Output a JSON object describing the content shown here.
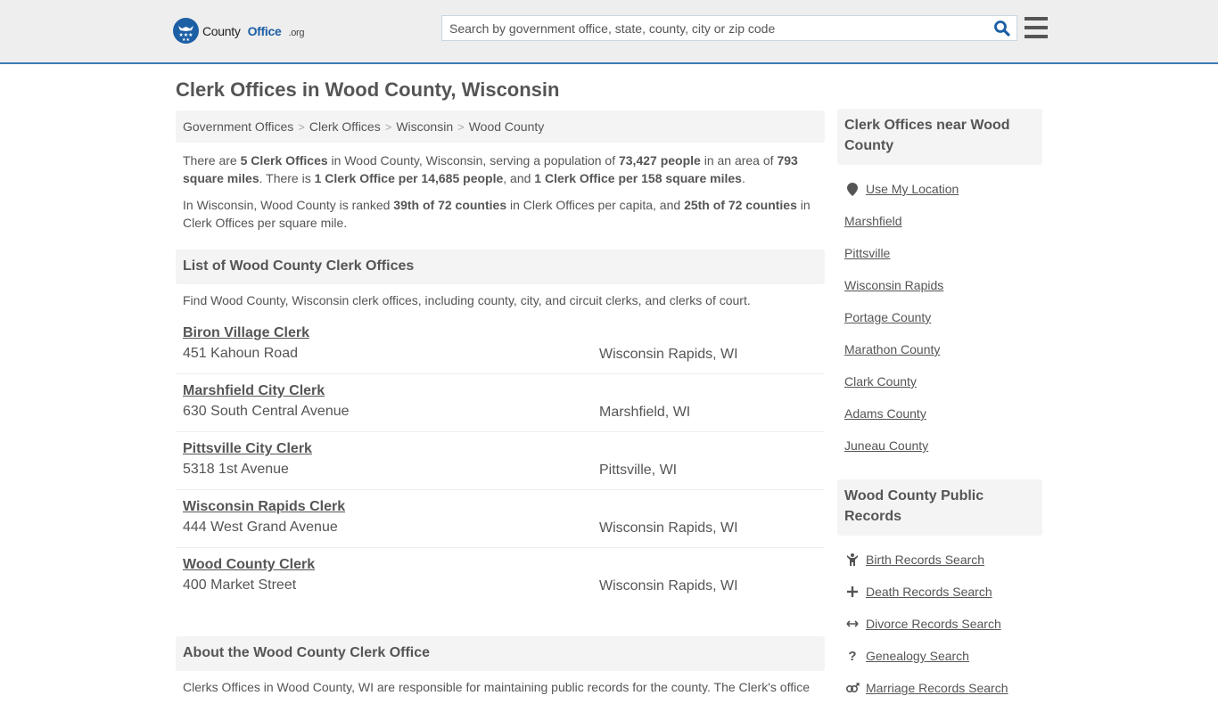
{
  "header": {
    "logo": {
      "brand_part1": "County",
      "brand_part2": "Office",
      "brand_suffix": ".org"
    },
    "search": {
      "placeholder": "Search by government office, state, county, city or zip code",
      "value": ""
    },
    "colors": {
      "brand_blue": "#1c5fa5",
      "header_border": "#3a7cb8"
    }
  },
  "page": {
    "title": "Clerk Offices in Wood County, Wisconsin"
  },
  "breadcrumb": [
    {
      "label": "Government Offices"
    },
    {
      "label": "Clerk Offices"
    },
    {
      "label": "Wisconsin"
    },
    {
      "label": "Wood County"
    }
  ],
  "intro": {
    "p1": {
      "t1": "There are ",
      "b1": "5 Clerk Offices",
      "t2": " in Wood County, Wisconsin, serving a population of ",
      "b2": "73,427 people",
      "t3": " in an area of ",
      "b3": "793 square miles",
      "t4": ". There is ",
      "b4": "1 Clerk Office per 14,685 people",
      "t5": ", and ",
      "b5": "1 Clerk Office per 158 square miles",
      "t6": "."
    },
    "p2": {
      "t1": "In Wisconsin, Wood County is ranked ",
      "b1": "39th of 72 counties",
      "t2": " in Clerk Offices per capita, and ",
      "b2": "25th of 72 counties",
      "t3": " in Clerk Offices per square mile."
    }
  },
  "list": {
    "heading": "List of Wood County Clerk Offices",
    "description": "Find Wood County, Wisconsin clerk offices, including county, city, and circuit clerks, and clerks of court.",
    "offices": [
      {
        "name": "Biron Village Clerk",
        "address": "451 Kahoun Road",
        "city": "Wisconsin Rapids, WI"
      },
      {
        "name": "Marshfield City Clerk",
        "address": "630 South Central Avenue",
        "city": "Marshfield, WI"
      },
      {
        "name": "Pittsville City Clerk",
        "address": "5318 1st Avenue",
        "city": "Pittsville, WI"
      },
      {
        "name": "Wisconsin Rapids Clerk",
        "address": "444 West Grand Avenue",
        "city": "Wisconsin Rapids, WI"
      },
      {
        "name": "Wood County Clerk",
        "address": "400 Market Street",
        "city": "Wisconsin Rapids, WI"
      }
    ]
  },
  "about": {
    "heading": "About the Wood County Clerk Office",
    "text": "Clerks Offices in Wood County, WI are responsible for maintaining public records for the county. The Clerk's office"
  },
  "sidebar": {
    "nearby": {
      "heading": "Clerk Offices near Wood County",
      "use_location": "Use My Location",
      "links": [
        "Marshfield",
        "Pittsville",
        "Wisconsin Rapids",
        "Portage County",
        "Marathon County",
        "Clark County",
        "Adams County",
        "Juneau County"
      ]
    },
    "records": {
      "heading": "Wood County Public Records",
      "links": [
        {
          "label": "Birth Records Search",
          "icon": "child-icon"
        },
        {
          "label": "Death Records Search",
          "icon": "plus-icon"
        },
        {
          "label": "Divorce Records Search",
          "icon": "arrows-horizontal-icon"
        },
        {
          "label": "Genealogy Search",
          "icon": "question-icon"
        },
        {
          "label": "Marriage Records Search",
          "icon": "venus-mars-icon"
        }
      ]
    }
  }
}
